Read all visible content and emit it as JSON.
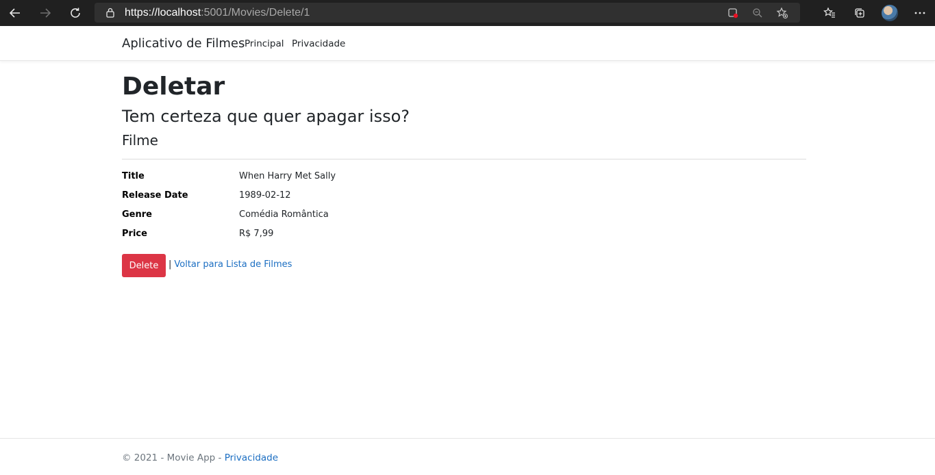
{
  "browser": {
    "url_host": "https://localhost",
    "url_rest": ":5001/Movies/Delete/1",
    "icons": [
      "back-arrow-icon",
      "forward-arrow-icon",
      "refresh-icon",
      "lock-icon",
      "app-install-icon",
      "zoom-icon",
      "add-favorite-icon",
      "favorites-icon",
      "collections-icon",
      "profile-avatar",
      "more-icon"
    ]
  },
  "nav": {
    "brand": "Aplicativo de Filmes",
    "links": [
      "Principal",
      "Privacidade"
    ]
  },
  "page": {
    "title": "Deletar",
    "question": "Tem certeza que quer apagar isso?",
    "entity": "Filme"
  },
  "details": {
    "fields": [
      {
        "label": "Title",
        "value": "When Harry Met Sally"
      },
      {
        "label": "Release Date",
        "value": "1989-02-12"
      },
      {
        "label": "Genre",
        "value": "Comédia Romântica"
      },
      {
        "label": "Price",
        "value": "R$ 7,99"
      }
    ]
  },
  "actions": {
    "delete_label": "Delete",
    "separator": "|",
    "back_label": "Voltar para Lista de Filmes"
  },
  "footer": {
    "text": "© 2021 - Movie App - ",
    "link": "Privacidade"
  },
  "colors": {
    "danger": "#dc3545",
    "link": "#1b6ec2",
    "browser_dark": "#202020"
  }
}
